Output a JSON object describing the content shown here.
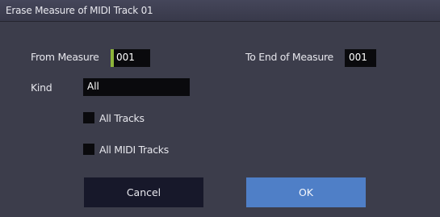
{
  "dialog": {
    "title": "Erase Measure of MIDI Track 01",
    "from_measure": {
      "label": "From Measure",
      "value": "001"
    },
    "to_end_measure": {
      "label": "To End of Measure",
      "value": "001"
    },
    "kind": {
      "label": "Kind",
      "value": "All"
    },
    "options": [
      {
        "label": "All Tracks",
        "checked": false
      },
      {
        "label": "All MIDI Tracks",
        "checked": false
      }
    ],
    "buttons": {
      "cancel": "Cancel",
      "ok": "OK"
    }
  },
  "colors": {
    "background": "#3c3d4b",
    "field": "#0a0a0d",
    "selection_accent": "#8cb43a",
    "ok_button": "#4f7fc7",
    "cancel_button": "#17182a"
  }
}
